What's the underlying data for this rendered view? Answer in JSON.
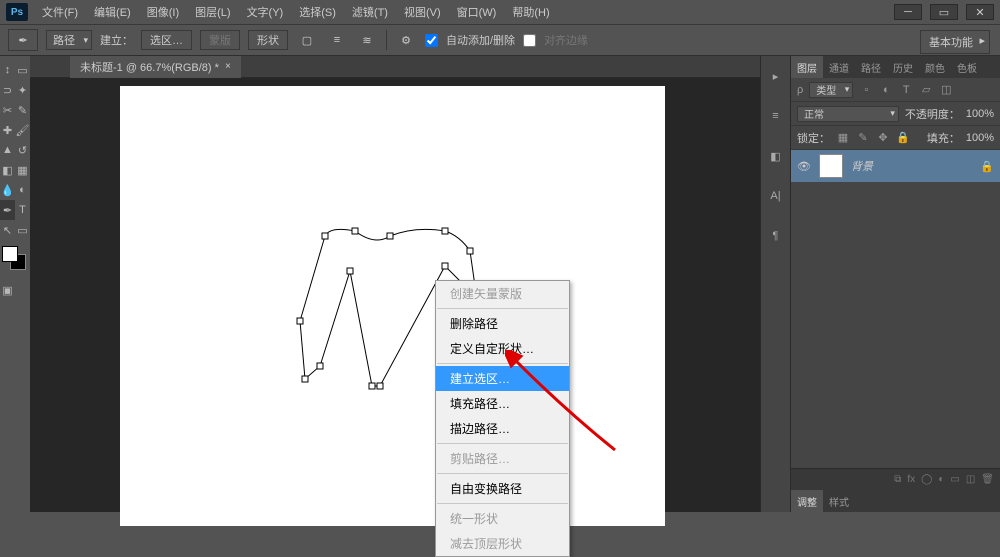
{
  "app": {
    "logo": "Ps"
  },
  "menu": [
    "文件(F)",
    "编辑(E)",
    "图像(I)",
    "图层(L)",
    "文字(Y)",
    "选择(S)",
    "滤镜(T)",
    "视图(V)",
    "窗口(W)",
    "帮助(H)"
  ],
  "optbar": {
    "path_mode": "路径",
    "make_label": "建立：",
    "sel_btn": "选区…",
    "mask_btn": "蒙版",
    "shape_btn": "形状",
    "auto_label": "自动添加/删除",
    "align_label": "对齐边缘"
  },
  "workspace_label": "基本功能",
  "doc": {
    "tab_title": "未标题-1 @ 66.7%(RGB/8) *"
  },
  "panels": {
    "group_tabs": [
      "图层",
      "通道",
      "路径",
      "历史",
      "颜色",
      "色板"
    ],
    "kind_label": "类型",
    "blend_mode": "正常",
    "opacity_label": "不透明度：",
    "opacity_val": "100%",
    "lock_label": "锁定：",
    "fill_label": "填充：",
    "fill_val": "100%",
    "layer_name": "背景",
    "bottom_tabs": [
      "调整",
      "样式"
    ]
  },
  "context_menu": {
    "items": [
      {
        "label": "创建矢量蒙版",
        "disabled": true
      },
      {
        "label": "删除路径"
      },
      {
        "label": "定义自定形状…"
      },
      {
        "label": "建立选区…",
        "highlight": true
      },
      {
        "label": "填充路径…"
      },
      {
        "label": "描边路径…"
      },
      {
        "label": "剪贴路径…",
        "disabled": true
      },
      {
        "label": "自由变换路径"
      },
      {
        "label": "统一形状",
        "disabled": true
      },
      {
        "label": "减去顶层形状",
        "disabled": true
      }
    ]
  }
}
